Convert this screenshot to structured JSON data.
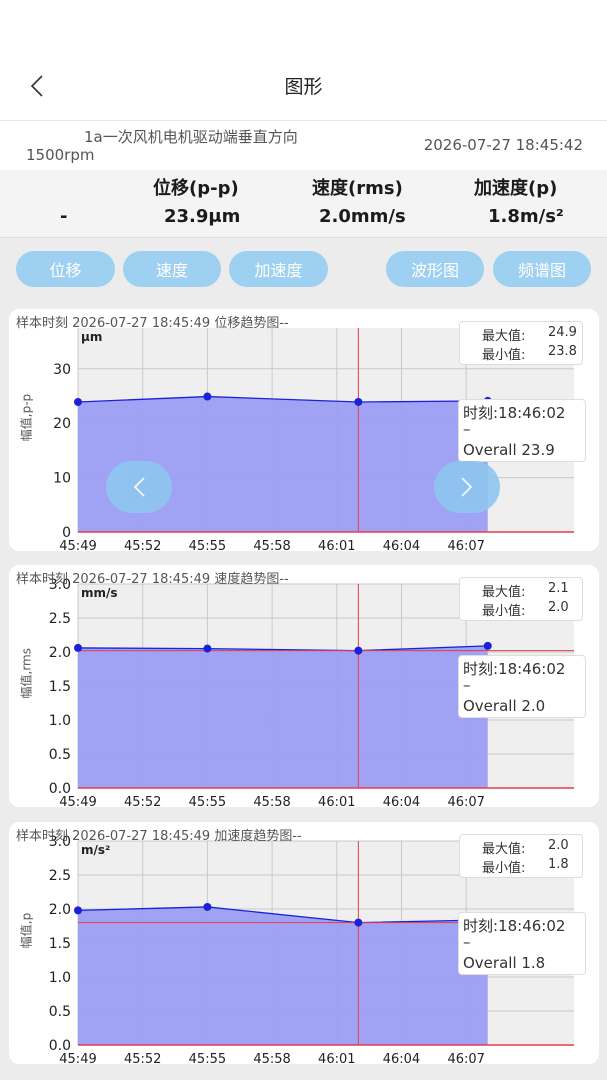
{
  "header": {
    "title": "图形"
  },
  "info": {
    "name": "1a一次风机电机驱动端垂直方向",
    "speed": "1500rpm",
    "time": "2026-07-27 18:45:42"
  },
  "metrics": {
    "col1_header": "",
    "col1_value": "-",
    "col2_header": "位移(p-p)",
    "col2_value": "23.9μm",
    "col3_header": "速度(rms)",
    "col3_value": "2.0mm/s",
    "col4_header": "加速度(p)",
    "col4_value": "1.8m/s²"
  },
  "buttons": {
    "displacement": "位移",
    "velocity": "速度",
    "acceleration": "加速度",
    "waveform": "波形图",
    "spectrum": "频谱图"
  },
  "colors": {
    "fill": "#9b9ef3",
    "line": "#1a22d8",
    "cursor": "#e53b4d",
    "button": "#9ed0f1"
  },
  "charts": [
    {
      "caption": "样本时刻 2026-07-27 18:45:49    位移趋势图--",
      "unit": "μm",
      "ylabel": "幅值,p-p",
      "max_label": "最大值:",
      "max_value": "24.9",
      "min_label": "最小值:",
      "min_value": "23.8",
      "tooltip_time": "时刻:18:46:02",
      "tooltip_dash": "–",
      "tooltip_overall": "Overall 23.9"
    },
    {
      "caption": "样本时刻 2026-07-27 18:45:49    速度趋势图--",
      "unit": "mm/s",
      "ylabel": "幅值,rms",
      "max_label": "最大值:",
      "max_value": "2.1",
      "min_label": "最小值:",
      "min_value": "2.0",
      "tooltip_time": "时刻:18:46:02",
      "tooltip_dash": "–",
      "tooltip_overall": "Overall 2.0"
    },
    {
      "caption": "样本时刻 2026-07-27 18:45:49  加速度趋势图--",
      "unit": "m/s²",
      "ylabel": "幅值,p",
      "max_label": "最大值:",
      "max_value": "2.0",
      "min_label": "最小值:",
      "min_value": "1.8",
      "tooltip_time": "时刻:18:46:02",
      "tooltip_dash": "–",
      "tooltip_overall": "Overall 1.8"
    }
  ],
  "chart_data": [
    {
      "type": "area",
      "x": [
        "45:49",
        "45:55",
        "46:02",
        "46:08"
      ],
      "y": [
        23.9,
        24.9,
        23.9,
        24.1
      ],
      "xticks": [
        "45:49",
        "45:52",
        "45:55",
        "45:58",
        "46:01",
        "46:04",
        "46:07"
      ],
      "yticks": [
        "0",
        "10",
        "20",
        "30"
      ],
      "ylim": [
        0,
        37.5
      ],
      "cursor_x": "46:02",
      "hline": null,
      "grid": true
    },
    {
      "type": "area",
      "x": [
        "45:49",
        "45:55",
        "46:02",
        "46:08"
      ],
      "y": [
        2.06,
        2.05,
        2.02,
        2.09
      ],
      "xticks": [
        "45:49",
        "45:52",
        "45:55",
        "45:58",
        "46:01",
        "46:04",
        "46:07"
      ],
      "yticks": [
        "0.0",
        "0.5",
        "1.0",
        "1.5",
        "2.0",
        "2.5",
        "3.0"
      ],
      "ylim": [
        0,
        3.0
      ],
      "cursor_x": "46:02",
      "hline": 2.02,
      "grid": true
    },
    {
      "type": "area",
      "x": [
        "45:49",
        "45:55",
        "46:02",
        "46:08"
      ],
      "y": [
        1.98,
        2.03,
        1.8,
        1.84
      ],
      "xticks": [
        "45:49",
        "45:52",
        "45:55",
        "45:58",
        "46:01",
        "46:04",
        "46:07"
      ],
      "yticks": [
        "0.0",
        "0.5",
        "1.0",
        "1.5",
        "2.0",
        "2.5",
        "3.0"
      ],
      "ylim": [
        0,
        3.0
      ],
      "cursor_x": "46:02",
      "hline": 1.8,
      "grid": true
    }
  ]
}
